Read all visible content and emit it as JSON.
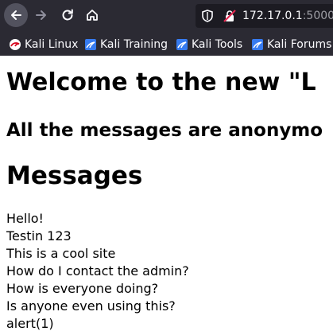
{
  "browser": {
    "url_host": "172.17.0.1",
    "url_port": ":5000",
    "bookmarks": [
      {
        "label": "Kali Linux",
        "icon": "kali-linux-icon"
      },
      {
        "label": "Kali Training",
        "icon": "kali-training-icon"
      },
      {
        "label": "Kali Tools",
        "icon": "kali-tools-icon"
      },
      {
        "label": "Kali Forums",
        "icon": "kali-forums-icon"
      }
    ],
    "colors": {
      "chrome_bg": "#2b2a33",
      "urlbar_bg": "#1c1b22",
      "text": "#fbfbfe"
    }
  },
  "page": {
    "title": "Welcome to the new \"L",
    "subtitle": "All the messages are anonymo",
    "messages_heading": "Messages",
    "messages": [
      "Hello!",
      "Testin 123",
      "This is a cool site",
      "How do I contact the admin?",
      "How is everyone doing?",
      "Is anyone even using this?",
      "alert(1)"
    ]
  }
}
